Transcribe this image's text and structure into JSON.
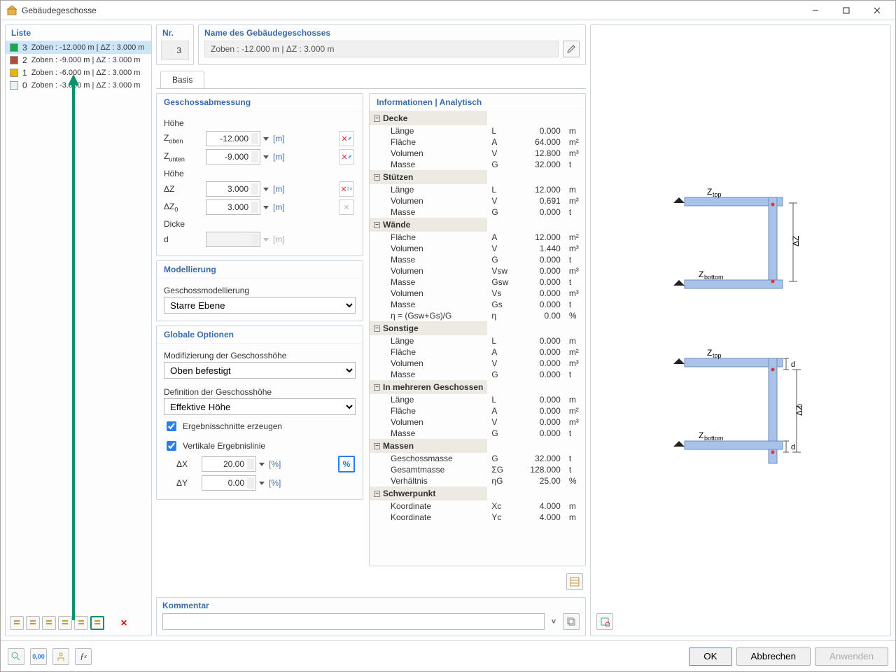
{
  "window": {
    "title": "Gebäudegeschosse"
  },
  "list": {
    "title": "Liste",
    "items": [
      {
        "idx": "3",
        "label": "Zoben : -12.000 m | ΔZ : 3.000 m",
        "color": "#1aa84f",
        "selected": true
      },
      {
        "idx": "2",
        "label": "Zoben : -9.000 m | ΔZ : 3.000 m",
        "color": "#b5493f",
        "selected": false
      },
      {
        "idx": "1",
        "label": "Zoben : -6.000 m | ΔZ : 3.000 m",
        "color": "#e6b800",
        "selected": false
      },
      {
        "idx": "0",
        "label": "Zoben : -3.000 m | ΔZ : 3.000 m",
        "color": "#e8f4fb",
        "selected": false
      }
    ]
  },
  "header": {
    "nr_label": "Nr.",
    "nr_value": "3",
    "name_label": "Name des Gebäudegeschosses",
    "name_value": "Zoben : -12.000 m | ΔZ : 3.000 m"
  },
  "tab": "Basis",
  "dim": {
    "title": "Geschossabmessung",
    "hoehe": "Höhe",
    "z_oben": "-12.000",
    "z_unten": "-9.000",
    "dz": "3.000",
    "dz0": "3.000",
    "dicke": "Dicke",
    "d": "",
    "unit_m": "[m]",
    "lbl_z_oben": "Z",
    "sub_oben": "oben",
    "lbl_z_unten": "Z",
    "sub_unten": "unten",
    "lbl_dz": "ΔZ",
    "lbl_dz0": "ΔZ",
    "sub_dz0": "0",
    "lbl_d": "d"
  },
  "mod": {
    "title": "Modellierung",
    "lbl": "Geschossmodellierung",
    "value": "Starre Ebene"
  },
  "glob": {
    "title": "Globale Optionen",
    "lbl1": "Modifizierung der Geschosshöhe",
    "val1": "Oben befestigt",
    "lbl2": "Definition der Geschosshöhe",
    "val2": "Effektive Höhe",
    "chk1": "Ergebnisschnitte erzeugen",
    "chk2": "Vertikale Ergebnislinie",
    "dx_lbl": "ΔX",
    "dx": "20.00",
    "dy_lbl": "ΔY",
    "dy": "0.00",
    "pct": "[%]"
  },
  "info": {
    "title": "Informationen | Analytisch",
    "groups": [
      {
        "name": "Decke",
        "rows": [
          [
            "Länge",
            "L",
            "0.000",
            "m"
          ],
          [
            "Fläche",
            "A",
            "64.000",
            "m²"
          ],
          [
            "Volumen",
            "V",
            "12.800",
            "m³"
          ],
          [
            "Masse",
            "G",
            "32.000",
            "t"
          ]
        ]
      },
      {
        "name": "Stützen",
        "rows": [
          [
            "Länge",
            "L",
            "12.000",
            "m"
          ],
          [
            "Volumen",
            "V",
            "0.691",
            "m³"
          ],
          [
            "Masse",
            "G",
            "0.000",
            "t"
          ]
        ]
      },
      {
        "name": "Wände",
        "rows": [
          [
            "Fläche",
            "A",
            "12.000",
            "m²"
          ],
          [
            "Volumen",
            "V",
            "1.440",
            "m³"
          ],
          [
            "Masse",
            "G",
            "0.000",
            "t"
          ],
          [
            "Volumen",
            "Vsw",
            "0.000",
            "m³"
          ],
          [
            "Masse",
            "Gsw",
            "0.000",
            "t"
          ],
          [
            "Volumen",
            "Vs",
            "0.000",
            "m³"
          ],
          [
            "Masse",
            "Gs",
            "0.000",
            "t"
          ],
          [
            "η = (Gsw+Gs)/G",
            "η",
            "0.00",
            "%"
          ]
        ]
      },
      {
        "name": "Sonstige",
        "rows": [
          [
            "Länge",
            "L",
            "0.000",
            "m"
          ],
          [
            "Fläche",
            "A",
            "0.000",
            "m²"
          ],
          [
            "Volumen",
            "V",
            "0.000",
            "m³"
          ],
          [
            "Masse",
            "G",
            "0.000",
            "t"
          ]
        ]
      },
      {
        "name": "In mehreren Geschossen",
        "rows": [
          [
            "Länge",
            "L",
            "0.000",
            "m"
          ],
          [
            "Fläche",
            "A",
            "0.000",
            "m²"
          ],
          [
            "Volumen",
            "V",
            "0.000",
            "m³"
          ],
          [
            "Masse",
            "G",
            "0.000",
            "t"
          ]
        ]
      },
      {
        "name": "Massen",
        "rows": [
          [
            "Geschossmasse",
            "G",
            "32.000",
            "t"
          ],
          [
            "Gesamtmasse",
            "ΣG",
            "128.000",
            "t"
          ],
          [
            "Verhältnis",
            "ηG",
            "25.00",
            "%"
          ]
        ]
      },
      {
        "name": "Schwerpunkt",
        "rows": [
          [
            "Koordinate",
            "Xc",
            "4.000",
            "m"
          ],
          [
            "Koordinate",
            "Yc",
            "4.000",
            "m"
          ]
        ]
      }
    ]
  },
  "comment": {
    "title": "Kommentar",
    "value": ""
  },
  "footer": {
    "ok": "OK",
    "cancel": "Abbrechen",
    "apply": "Anwenden"
  },
  "diagram": {
    "z_top": "Z",
    "z_top_sub": "top",
    "z_bot": "Z",
    "z_bot_sub": "bottom",
    "dz": "ΔZ",
    "dz0": "ΔZ",
    "dz0_sub": "0",
    "d": "d"
  }
}
